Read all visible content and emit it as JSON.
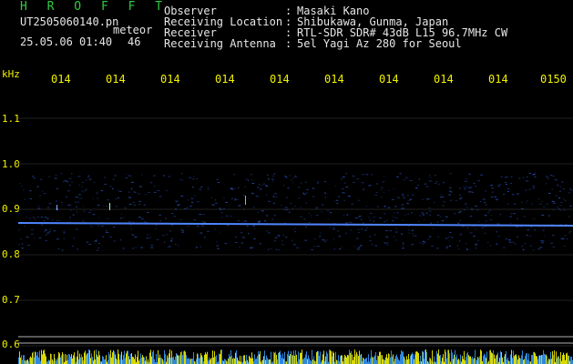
{
  "header": {
    "title": "H R O F F T",
    "filename": "UT2505060140.pn",
    "tag": "meteor",
    "datetime": "25.05.06 01:40",
    "count": "46",
    "info": [
      {
        "key": "Observer",
        "sep": ":",
        "value": "Masaki Kano"
      },
      {
        "key": "Receiving Location",
        "sep": ":",
        "value": "Shibukawa, Gunma, Japan"
      },
      {
        "key": "Receiver",
        "sep": ":",
        "value": "RTL-SDR SDR# 43dB L15 96.7MHz CW"
      },
      {
        "key": "Receiving Antenna",
        "sep": ":",
        "value": "5el Yagi Az 280 for Seoul"
      }
    ]
  },
  "chart_data": {
    "type": "heatmap",
    "yunit": "kHz",
    "y_ticks": [
      "1.1",
      "1.0",
      "0.9",
      "0.8",
      "0.7",
      "0.6"
    ],
    "x_ticks": [
      "014",
      "014",
      "014",
      "014",
      "014",
      "014",
      "014",
      "014",
      "014",
      "0150"
    ],
    "carrier_khz": 0.87,
    "colors": {
      "background": "#000000",
      "grid": "#1f1f1f",
      "signal": "#3a6dff",
      "carrier": "#4f86ff",
      "baseline": "#ffff00",
      "ref_lines": "#b0b0b0"
    }
  }
}
